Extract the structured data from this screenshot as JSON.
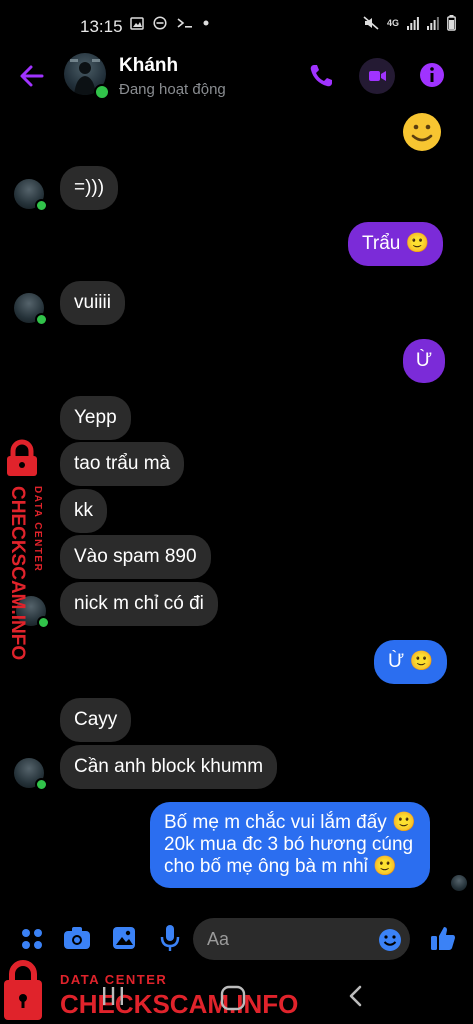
{
  "status_bar": {
    "time": "13:15",
    "left_icons": [
      "image-icon",
      "do-not-disturb-icon",
      "terminal-icon",
      "dot-icon"
    ],
    "right_icons": [
      "mute-icon",
      "4g-icon",
      "signal-icon",
      "signal-icon",
      "battery-icon"
    ],
    "network_label": "4G"
  },
  "header": {
    "name": "Khánh",
    "status": "Đang hoạt động",
    "accent_color": "#a033ff"
  },
  "messages": [
    {
      "side": "out",
      "type": "emoji",
      "text": "🙂"
    },
    {
      "side": "in",
      "text": "=)))"
    },
    {
      "side": "out",
      "text": "Trẩu 🙂"
    },
    {
      "side": "in",
      "text": "vuiiii"
    },
    {
      "side": "out",
      "text": "Ừ"
    },
    {
      "side": "in",
      "text": "Yepp"
    },
    {
      "side": "in",
      "text": "tao trẩu mà"
    },
    {
      "side": "in",
      "text": "kk"
    },
    {
      "side": "in",
      "text": "Vào spam 890"
    },
    {
      "side": "in",
      "text": "nick m chỉ có đi"
    },
    {
      "side": "out",
      "text": "Ừ 🙂"
    },
    {
      "side": "in",
      "text": "Cayy"
    },
    {
      "side": "in",
      "text": "Cần anh block khumm"
    },
    {
      "side": "out",
      "lines": [
        "Bố mẹ m chắc vui lắm đấy 🙂",
        "20k mua đc 3 bó hương cúng",
        "cho bố mẹ ông bà m nhỉ 🙂"
      ]
    }
  ],
  "composer": {
    "placeholder": "Aa",
    "icons": [
      "menu-icon",
      "camera-icon",
      "gallery-icon",
      "mic-icon",
      "emoji-icon",
      "like-icon"
    ]
  },
  "watermark": {
    "top_label": "DATA CENTER",
    "brand": "CHECKSCAM.INFO",
    "color": "#e0232b"
  },
  "colors": {
    "outgoing_purple": "#7b2bd8",
    "outgoing_blue": "#2b6ef0",
    "incoming": "#2b2b2b",
    "icon_blue": "#3b82f6"
  }
}
